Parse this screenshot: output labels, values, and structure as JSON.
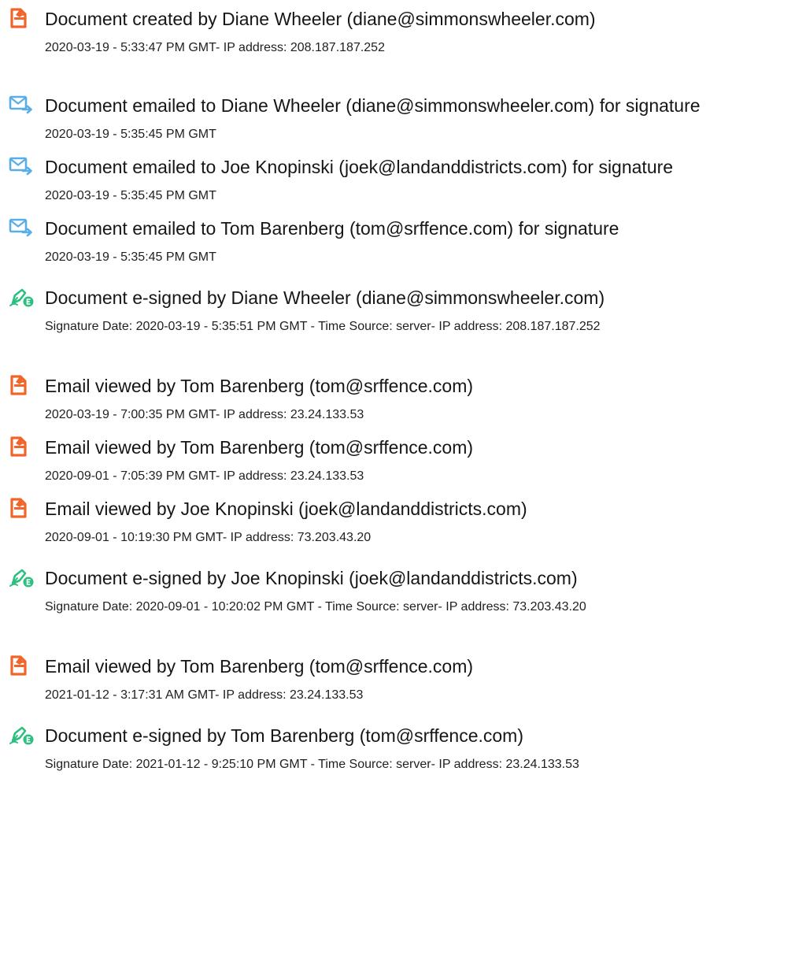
{
  "events": [
    {
      "icon": "document-created-icon",
      "title": "Document created by Diane Wheeler (diane@simmonswheeler.com)",
      "detail": "2020-03-19 - 5:33:47 PM GMT- IP address: 208.187.187.252"
    },
    {
      "icon": "email-sent-icon",
      "title": "Document emailed to Diane Wheeler (diane@simmonswheeler.com) for signature",
      "detail": "2020-03-19 - 5:35:45 PM GMT"
    },
    {
      "icon": "email-sent-icon",
      "title": "Document emailed to Joe Knopinski (joek@landanddistricts.com) for signature",
      "detail": "2020-03-19 - 5:35:45 PM GMT"
    },
    {
      "icon": "email-sent-icon",
      "title": "Document emailed to Tom Barenberg (tom@srffence.com) for signature",
      "detail": "2020-03-19 - 5:35:45 PM GMT"
    },
    {
      "icon": "e-signed-pen-icon",
      "title": "Document e-signed by Diane Wheeler (diane@simmonswheeler.com)",
      "detail": "Signature Date: 2020-03-19 - 5:35:51 PM GMT - Time Source: server- IP address: 208.187.187.252"
    },
    {
      "icon": "document-viewed-icon",
      "title": "Email viewed by Tom Barenberg (tom@srffence.com)",
      "detail": "2020-03-19 - 7:00:35 PM GMT- IP address: 23.24.133.53"
    },
    {
      "icon": "document-viewed-icon",
      "title": "Email viewed by Tom Barenberg (tom@srffence.com)",
      "detail": "2020-09-01 - 7:05:39 PM GMT- IP address: 23.24.133.53"
    },
    {
      "icon": "document-viewed-icon",
      "title": "Email viewed by Joe Knopinski (joek@landanddistricts.com)",
      "detail": "2020-09-01 - 10:19:30 PM GMT- IP address: 73.203.43.20"
    },
    {
      "icon": "e-signed-pen-icon",
      "title": "Document e-signed by Joe Knopinski (joek@landanddistricts.com)",
      "detail": "Signature Date: 2020-09-01 - 10:20:02 PM GMT - Time Source: server- IP address: 73.203.43.20"
    },
    {
      "icon": "document-viewed-icon",
      "title": "Email viewed by Tom Barenberg (tom@srffence.com)",
      "detail": "2021-01-12 - 3:17:31 AM GMT- IP address: 23.24.133.53"
    },
    {
      "icon": "e-signed-pen-icon",
      "title": "Document e-signed by Tom Barenberg (tom@srffence.com)",
      "detail": "Signature Date: 2021-01-12 - 9:25:10 PM GMT - Time Source: server- IP address: 23.24.133.53"
    }
  ],
  "colors": {
    "document_icon": "#f2652a",
    "email_icon": "#5aaee6",
    "pen_icon": "#2dbf80"
  }
}
